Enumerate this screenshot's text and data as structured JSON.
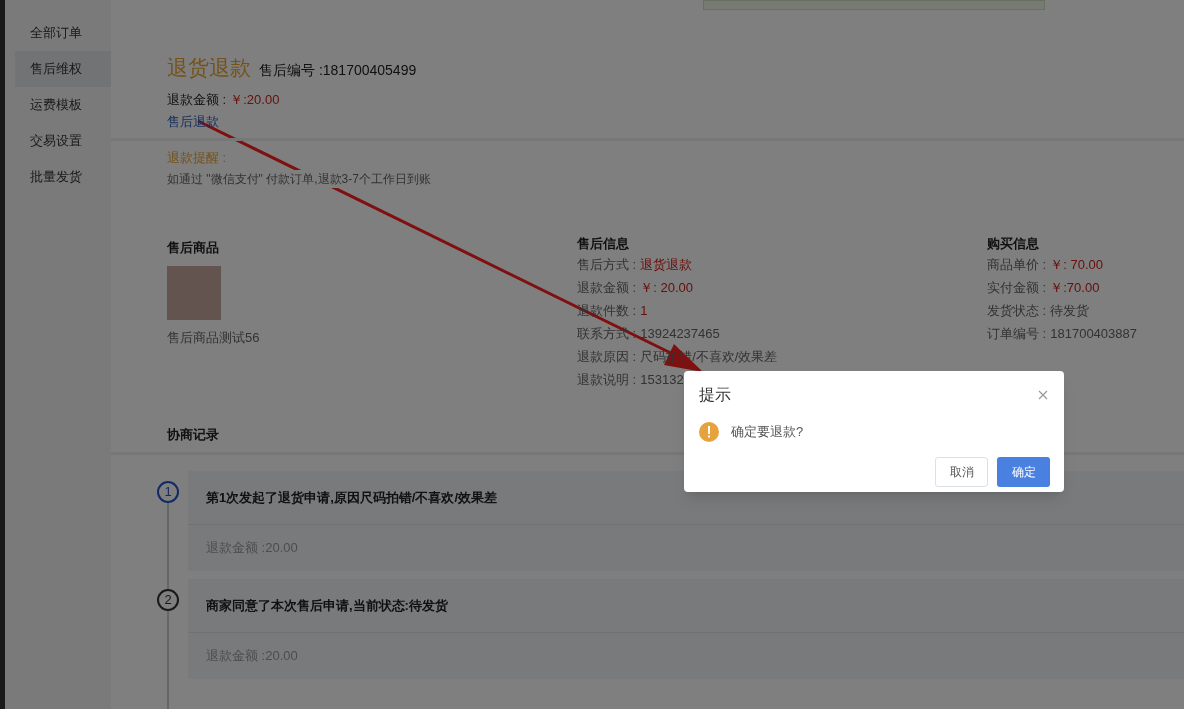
{
  "sidebar": {
    "items": [
      {
        "label": "全部订单",
        "selected": false
      },
      {
        "label": "售后维权",
        "selected": true
      },
      {
        "label": "运费模板",
        "selected": false
      },
      {
        "label": "交易设置",
        "selected": false
      },
      {
        "label": "批量发货",
        "selected": false
      }
    ]
  },
  "header": {
    "title": "退货退款",
    "number": "售后编号 :181700405499",
    "amount_label": "退款金额 :",
    "amount_value": "￥:20.00",
    "link": "售后退款"
  },
  "notice": {
    "title": "退款提醒 :",
    "text": "如通过 \"微信支付\" 付款订单,退款3-7个工作日到账"
  },
  "product": {
    "heading": "售后商品",
    "name": "售后商品测试56"
  },
  "after_sale_info": {
    "heading": "售后信息",
    "rows": [
      {
        "label": "售后方式 :",
        "value": "退货退款",
        "highlight": true
      },
      {
        "label": "退款金额 :",
        "value": "￥: 20.00",
        "highlight": true
      },
      {
        "label": "退款件数 :",
        "value": "1",
        "highlight": true
      },
      {
        "label": "联系方式 :",
        "value": "13924237465",
        "highlight": false
      },
      {
        "label": "退款原因 :",
        "value": "尺码拍错/不喜欢/效果差",
        "highlight": false
      },
      {
        "label": "退款说明 :",
        "value": "153132",
        "highlight": false
      }
    ]
  },
  "purchase_info": {
    "heading": "购买信息",
    "rows": [
      {
        "label": "商品单价 :",
        "value": "￥: 70.00",
        "highlight": true
      },
      {
        "label": "实付金额 :",
        "value": "￥:70.00",
        "highlight": true
      },
      {
        "label": "发货状态 :",
        "value": "待发货",
        "highlight": false
      },
      {
        "label": "订单编号 :",
        "value": "181700403887",
        "highlight": false
      }
    ]
  },
  "records": {
    "heading": "协商记录",
    "items": [
      {
        "index": "1",
        "title": "第1次发起了退货申请,原因尺码拍错/不喜欢/效果差",
        "detail": "退款金额 :20.00",
        "active": true
      },
      {
        "index": "2",
        "title": "商家同意了本次售后申请,当前状态:待发货",
        "detail": "退款金额 :20.00",
        "active": false
      }
    ]
  },
  "dialog": {
    "title": "提示",
    "message": "确定要退款?",
    "cancel": "取消",
    "confirm": "确定"
  }
}
